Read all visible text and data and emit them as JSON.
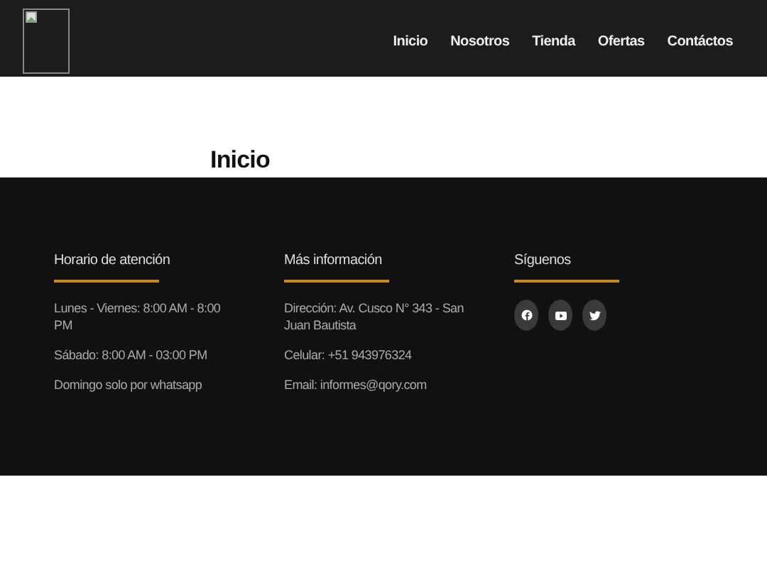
{
  "header": {
    "logo": {
      "kind": "broken-image"
    },
    "nav": [
      {
        "label": "Inicio"
      },
      {
        "label": "Nosotros"
      },
      {
        "label": "Tienda"
      },
      {
        "label": "Ofertas"
      },
      {
        "label": "Contáctos"
      }
    ]
  },
  "page_title": "Inicio",
  "footer": {
    "columns": [
      {
        "heading": "Horario de atención",
        "lines": [
          "Lunes - Viernes: 8:00 AM - 8:00 PM",
          "Sábado: 8:00 AM - 03:00 PM",
          "Domingo solo por whatsapp"
        ]
      },
      {
        "heading": "Más información",
        "lines": [
          "Dirección: Av. Cusco N° 343 - San Juan Bautista",
          "Celular: +51 943976324",
          "Email: informes@qory.com"
        ]
      },
      {
        "heading": "Síguenos",
        "social": [
          {
            "kind": "facebook"
          },
          {
            "kind": "youtube"
          },
          {
            "kind": "twitter"
          }
        ]
      }
    ]
  }
}
